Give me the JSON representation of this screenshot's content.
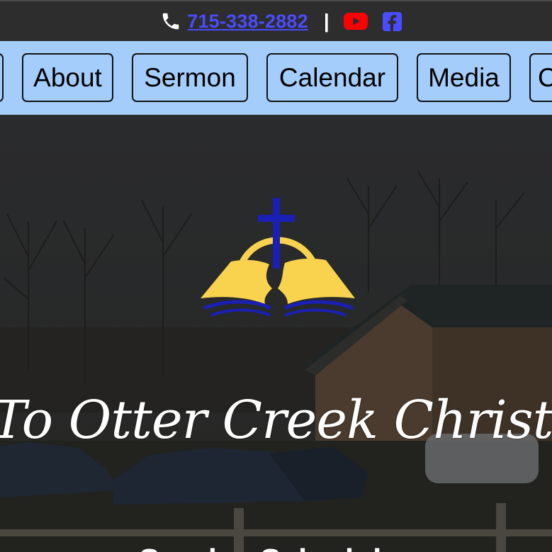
{
  "topbar": {
    "phone_icon": "phone-icon",
    "phone_number": "715-338-2882",
    "separator": "|",
    "youtube_icon": "youtube-icon",
    "facebook_icon": "facebook-icon",
    "link_color": "#4b4bff",
    "youtube_color": "#ff0000"
  },
  "nav": {
    "background": "#a5cdfb",
    "items": [
      {
        "label": ""
      },
      {
        "label": "About"
      },
      {
        "label": "Sermon"
      },
      {
        "label": "Calendar"
      },
      {
        "label": "Media"
      },
      {
        "label": "C"
      }
    ]
  },
  "hero": {
    "welcome_text": "To Otter Creek Christian",
    "schedule_heading": "Sunday Schedule",
    "logo": "church-logo-bible-cross",
    "logo_colors": {
      "gold": "#f9d24e",
      "blue": "#1a1fb5"
    }
  }
}
